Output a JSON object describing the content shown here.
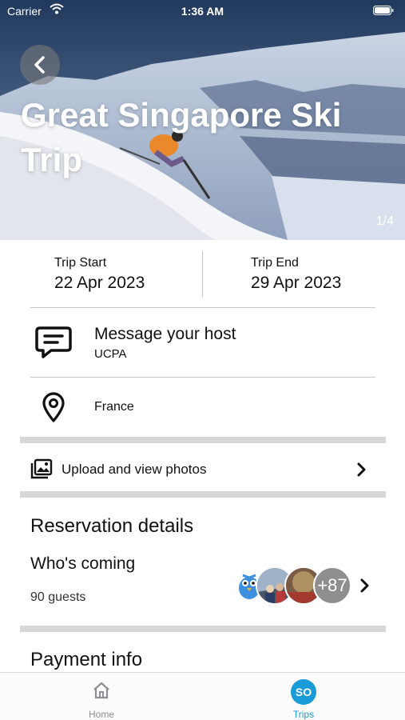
{
  "status_bar": {
    "carrier": "Carrier",
    "time": "1:36 AM"
  },
  "hero": {
    "title": "Great Singapore Ski Trip",
    "photo_counter": "1/4"
  },
  "trip_dates": {
    "start_label": "Trip Start",
    "start_value": "22 Apr 2023",
    "end_label": "Trip End",
    "end_value": "29 Apr 2023"
  },
  "host": {
    "title": "Message your host",
    "name": "UCPA",
    "icon": "chat-bubble-icon"
  },
  "location": {
    "text": "France",
    "icon": "map-pin-icon"
  },
  "photos": {
    "label": "Upload and view photos",
    "icon": "photo-album-icon"
  },
  "reservation": {
    "title": "Reservation details",
    "whos_coming_label": "Who's coming",
    "guest_count": "90 guests",
    "more_avatars": "+87"
  },
  "payment": {
    "title": "Payment info"
  },
  "tab_bar": {
    "tabs": [
      {
        "label": "Home",
        "icon": "home-icon"
      },
      {
        "label": "Trips",
        "badge": "SO"
      }
    ]
  },
  "colors": {
    "accent": "#1a9bd7",
    "inactive_tab": "#8e8e93",
    "divider": "#d7d7d7"
  }
}
